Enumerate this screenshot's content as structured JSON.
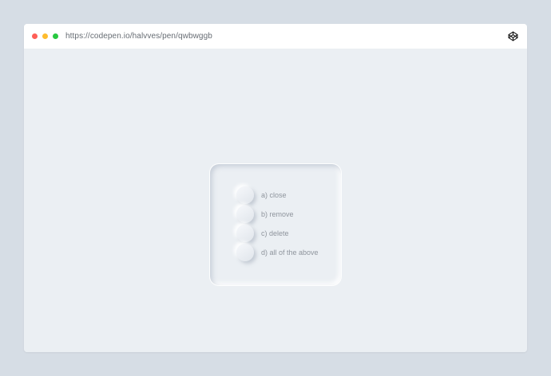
{
  "browser": {
    "url": "https://codepen.io/halvves/pen/qwbwggb",
    "brand_icon": "codepen-icon"
  },
  "quiz": {
    "options": [
      {
        "label": "a) close"
      },
      {
        "label": "b) remove"
      },
      {
        "label": "c) delete"
      },
      {
        "label": "d) all of the above"
      }
    ]
  },
  "colors": {
    "page_background": "#d6dde5",
    "content_background": "#ebeff3",
    "titlebar_background": "#ffffff",
    "close_dot": "#fe5f57",
    "minimize_dot": "#febc2e",
    "maximize_dot": "#28c840",
    "label_text": "#8f959d"
  }
}
